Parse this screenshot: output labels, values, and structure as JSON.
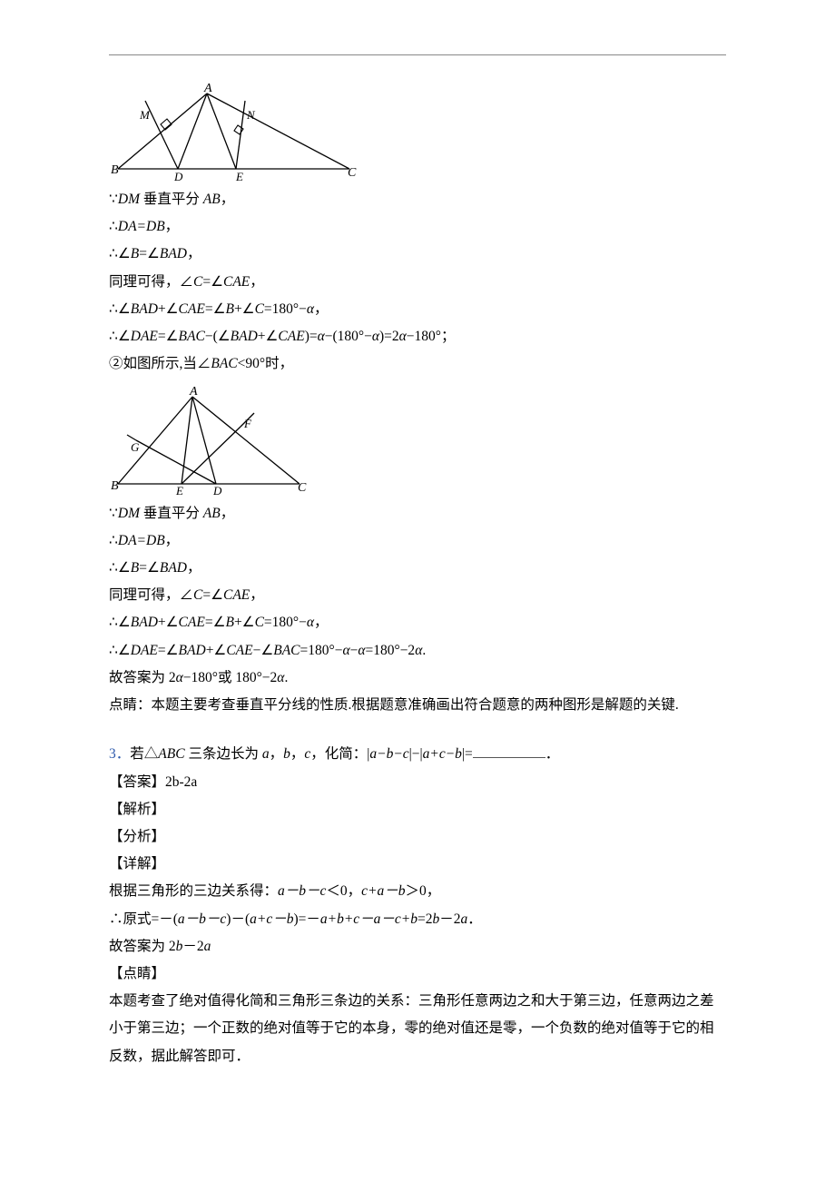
{
  "hr": "",
  "proof1": {
    "l1a": "∵",
    "l1b": "DM",
    "l1c": " 垂直平分 ",
    "l1d": "AB",
    "l1e": "，",
    "l2a": "∴",
    "l2b": "DA=DB",
    "l2c": "，",
    "l3a": "∴∠",
    "l3b": "B",
    "l3c": "=∠",
    "l3d": "BAD",
    "l3e": "，",
    "l4a": "同理可得，∠",
    "l4b": "C",
    "l4c": "=∠",
    "l4d": "CAE",
    "l4e": "，",
    "l5a": "∴∠",
    "l5b": "BAD",
    "l5c": "+∠",
    "l5d": "CAE",
    "l5e": "=∠",
    "l5f": "B",
    "l5g": "+∠",
    "l5h": "C",
    "l5i": "=180°−",
    "l5j": "α",
    "l5k": "，",
    "l6a": "∴∠",
    "l6b": "DAE",
    "l6c": "=∠",
    "l6d": "BAC",
    "l6e": "−(∠",
    "l6f": "BAD",
    "l6g": "+∠",
    "l6h": "CAE",
    "l6i": ")=",
    "l6j": "α",
    "l6k": "−(180°−",
    "l6l": "α",
    "l6m": ")=2",
    "l6n": "α",
    "l6o": "−180°；",
    "l7a": "②如图所示,当∠",
    "l7b": "BAC",
    "l7c": "<90°时，"
  },
  "proof2": {
    "l1a": "∵",
    "l1b": "DM",
    "l1c": " 垂直平分 ",
    "l1d": "AB",
    "l1e": "，",
    "l2a": "∴",
    "l2b": "DA=DB",
    "l2c": "，",
    "l3a": "∴∠",
    "l3b": "B",
    "l3c": "=∠",
    "l3d": "BAD",
    "l3e": "，",
    "l4a": "同理可得，∠",
    "l4b": "C",
    "l4c": "=∠",
    "l4d": "CAE",
    "l4e": "，",
    "l5a": "∴∠",
    "l5b": "BAD",
    "l5c": "+∠",
    "l5d": "CAE",
    "l5e": "=∠",
    "l5f": "B",
    "l5g": "+∠",
    "l5h": "C",
    "l5i": "=180°−",
    "l5j": "α",
    "l5k": "，",
    "l6a": "∴∠",
    "l6b": "DAE",
    "l6c": "=∠",
    "l6d": "BAD",
    "l6e": "+∠",
    "l6f": "CAE",
    "l6g": "−∠",
    "l6h": "BAC",
    "l6i": "=180°−",
    "l6j": "α",
    "l6k": "−",
    "l6l": "α",
    "l6m": "=180°−2",
    "l6n": "α",
    "l6o": ".",
    "l7a": "故答案为 2",
    "l7b": "α",
    "l7c": "−180°或 180°−2",
    "l7d": "α",
    "l7e": ".",
    "l8": "点睛：本题主要考查垂直平分线的性质.根据题意准确画出符合题意的两种图形是解题的关键."
  },
  "q3": {
    "num": "3．",
    "stem_a": "若△",
    "stem_b": "ABC",
    "stem_c": " 三条边长为 ",
    "stem_d": "a",
    "stem_e": "，",
    "stem_f": "b",
    "stem_g": "，",
    "stem_h": "c",
    "stem_i": "，化简：|",
    "stem_j": "a−b−c",
    "stem_k": "|−|",
    "stem_l": "a+c−b",
    "stem_m": "|=",
    "stem_n": "．",
    "ans_label": "【答案】",
    "ans": "2b-2a",
    "sec_analysis": "【解析】",
    "sec_fenxi": "【分析】",
    "sec_detail": "【详解】",
    "d1a": "根据三角形的三边关系得：",
    "d1b": "a－b－c",
    "d1c": "＜0，",
    "d1d": "c+a－b",
    "d1e": "＞0，",
    "d2a": "∴原式=－(",
    "d2b": "a－b－c",
    "d2c": ")－(",
    "d2d": "a+c－b",
    "d2e": ")=－",
    "d2f": "a+b+c－a－c+b",
    "d2g": "=2",
    "d2h": "b",
    "d2i": "－2",
    "d2j": "a",
    "d2k": "．",
    "d3a": "故答案为 2",
    "d3b": "b",
    "d3c": "－2",
    "d3d": "a",
    "sec_dianjing": "【点睛】",
    "dj": "本题考查了绝对值得化简和三角形三条边的关系：三角形任意两边之和大于第三边，任意两边之差小于第三边；一个正数的绝对值等于它的本身，零的绝对值还是零，一个负数的绝对值等于它的相反数，据此解答即可．"
  },
  "diagram1": {
    "A": "A",
    "B": "B",
    "C": "C",
    "D": "D",
    "E": "E",
    "M": "M",
    "N": "N"
  },
  "diagram2": {
    "A": "A",
    "B": "B",
    "C": "C",
    "D": "D",
    "E": "E",
    "F": "F",
    "G": "G"
  }
}
